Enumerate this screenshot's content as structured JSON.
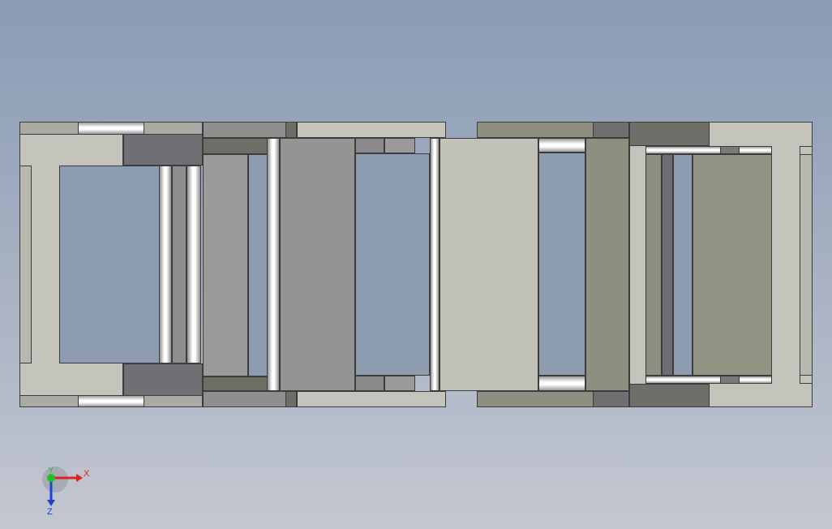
{
  "triad": {
    "x_label": "X",
    "y_label": "Y",
    "z_label": "Z",
    "x_color": "#e02020",
    "y_color": "#20c020",
    "z_color": "#2040d0"
  },
  "colors": {
    "background_top": "#8a9bb3",
    "background_bottom": "#c3c7d1",
    "part_light": "#c2c2ba",
    "part_mid": "#8f8f8d",
    "part_dark": "#6e6e72",
    "part_olive": "#8e8f80",
    "edge": "#3c3c3c"
  }
}
